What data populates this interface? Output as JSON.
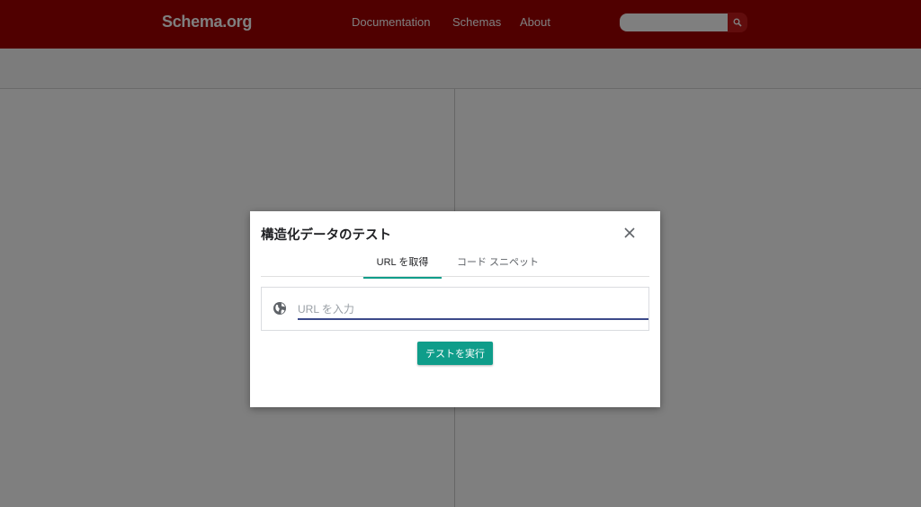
{
  "header": {
    "logo": "Schema.org",
    "nav": [
      "Documentation",
      "Schemas",
      "About"
    ],
    "search_placeholder": ""
  },
  "dialog": {
    "title": "構造化データのテスト",
    "tabs": [
      {
        "label": "URL を取得",
        "active": true
      },
      {
        "label": "コード スニペット",
        "active": false
      }
    ],
    "url_placeholder": "URL を入力",
    "url_value": "",
    "run_label": "テストを実行"
  },
  "colors": {
    "header_bg": "#a00000",
    "accent": "#0f9d8a",
    "input_underline": "#3c4a8a"
  }
}
